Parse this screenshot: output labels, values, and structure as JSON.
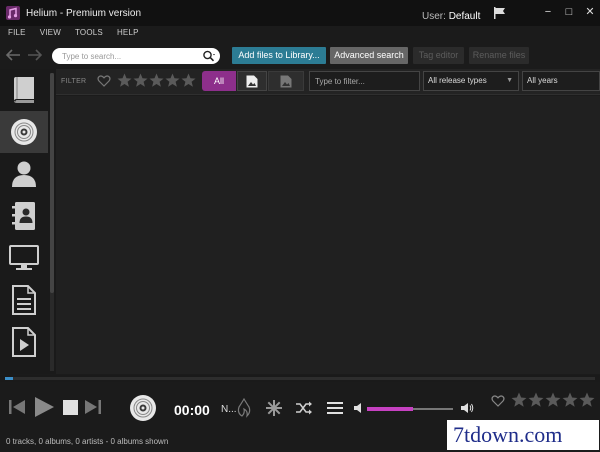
{
  "window": {
    "title": "Helium - Premium version",
    "user_label": "User:",
    "user_name": "Default",
    "minimize": "−",
    "maximize": "□",
    "close": "✕"
  },
  "menu": [
    "FILE",
    "VIEW",
    "TOOLS",
    "HELP"
  ],
  "toolbar": {
    "back_icon": "back-arrow-icon",
    "forward_icon": "forward-arrow-icon",
    "search_placeholder": "Type to search...",
    "add_files_label": "Add files to Library...",
    "advanced_search_label": "Advanced search",
    "tag_editor_label": "Tag editor",
    "rename_files_label": "Rename files"
  },
  "sidebar": {
    "items": [
      {
        "name": "library",
        "icon": "book-icon",
        "active": false
      },
      {
        "name": "albums",
        "icon": "disc-icon",
        "active": true
      },
      {
        "name": "artists",
        "icon": "person-icon",
        "active": false
      },
      {
        "name": "contacts",
        "icon": "address-book-icon",
        "active": false
      },
      {
        "name": "monitor",
        "icon": "monitor-icon",
        "active": false
      },
      {
        "name": "documents",
        "icon": "document-icon",
        "active": false
      },
      {
        "name": "video",
        "icon": "play-file-icon",
        "active": false
      }
    ]
  },
  "filter": {
    "label": "FILTER",
    "all_label": "All",
    "text_placeholder": "Type to filter...",
    "release_types": "All release types",
    "years": "All years",
    "rating_stars": 5
  },
  "player": {
    "time": "00:00",
    "now_playing": "N...",
    "volume_fraction": 0.53,
    "rating_stars": 5
  },
  "status": {
    "text": "0 tracks, 0 albums, 0 artists - 0 albums shown"
  },
  "watermark": {
    "text": "7tdown.com"
  },
  "colors": {
    "accent_purple": "#8d2f8b",
    "volume_pink": "#c641c1",
    "button_teal": "#2c7c94",
    "progress_blue": "#3b8ec8"
  }
}
